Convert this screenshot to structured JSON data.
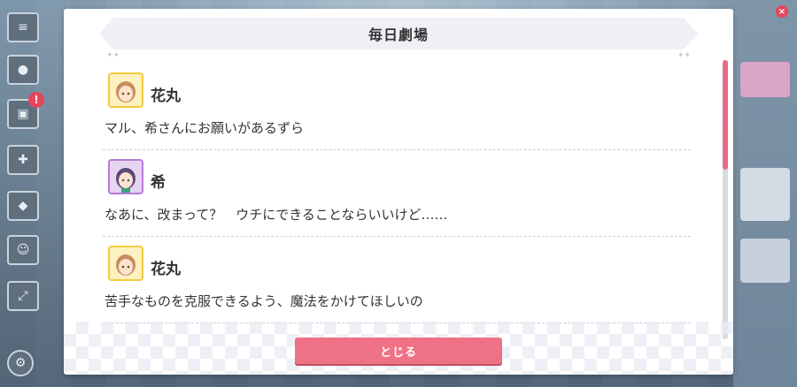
{
  "dialog": {
    "title": "毎日劇場",
    "close_label": "とじる",
    "accent_color": "#ef7186"
  },
  "log": [
    {
      "speaker": "花丸",
      "line": "マル、希さんにお願いがあるずら",
      "avatar": "hanamaru-avatar"
    },
    {
      "speaker": "希",
      "line": "なあに、改まって？　ウチにできることならいいけど……",
      "avatar": "nozomi-avatar"
    },
    {
      "speaker": "花丸",
      "line": "苦手なものを克服できるよう、魔法をかけてほしいの",
      "avatar": "hanamaru-avatar"
    }
  ],
  "background": {
    "side_badge": "!"
  }
}
